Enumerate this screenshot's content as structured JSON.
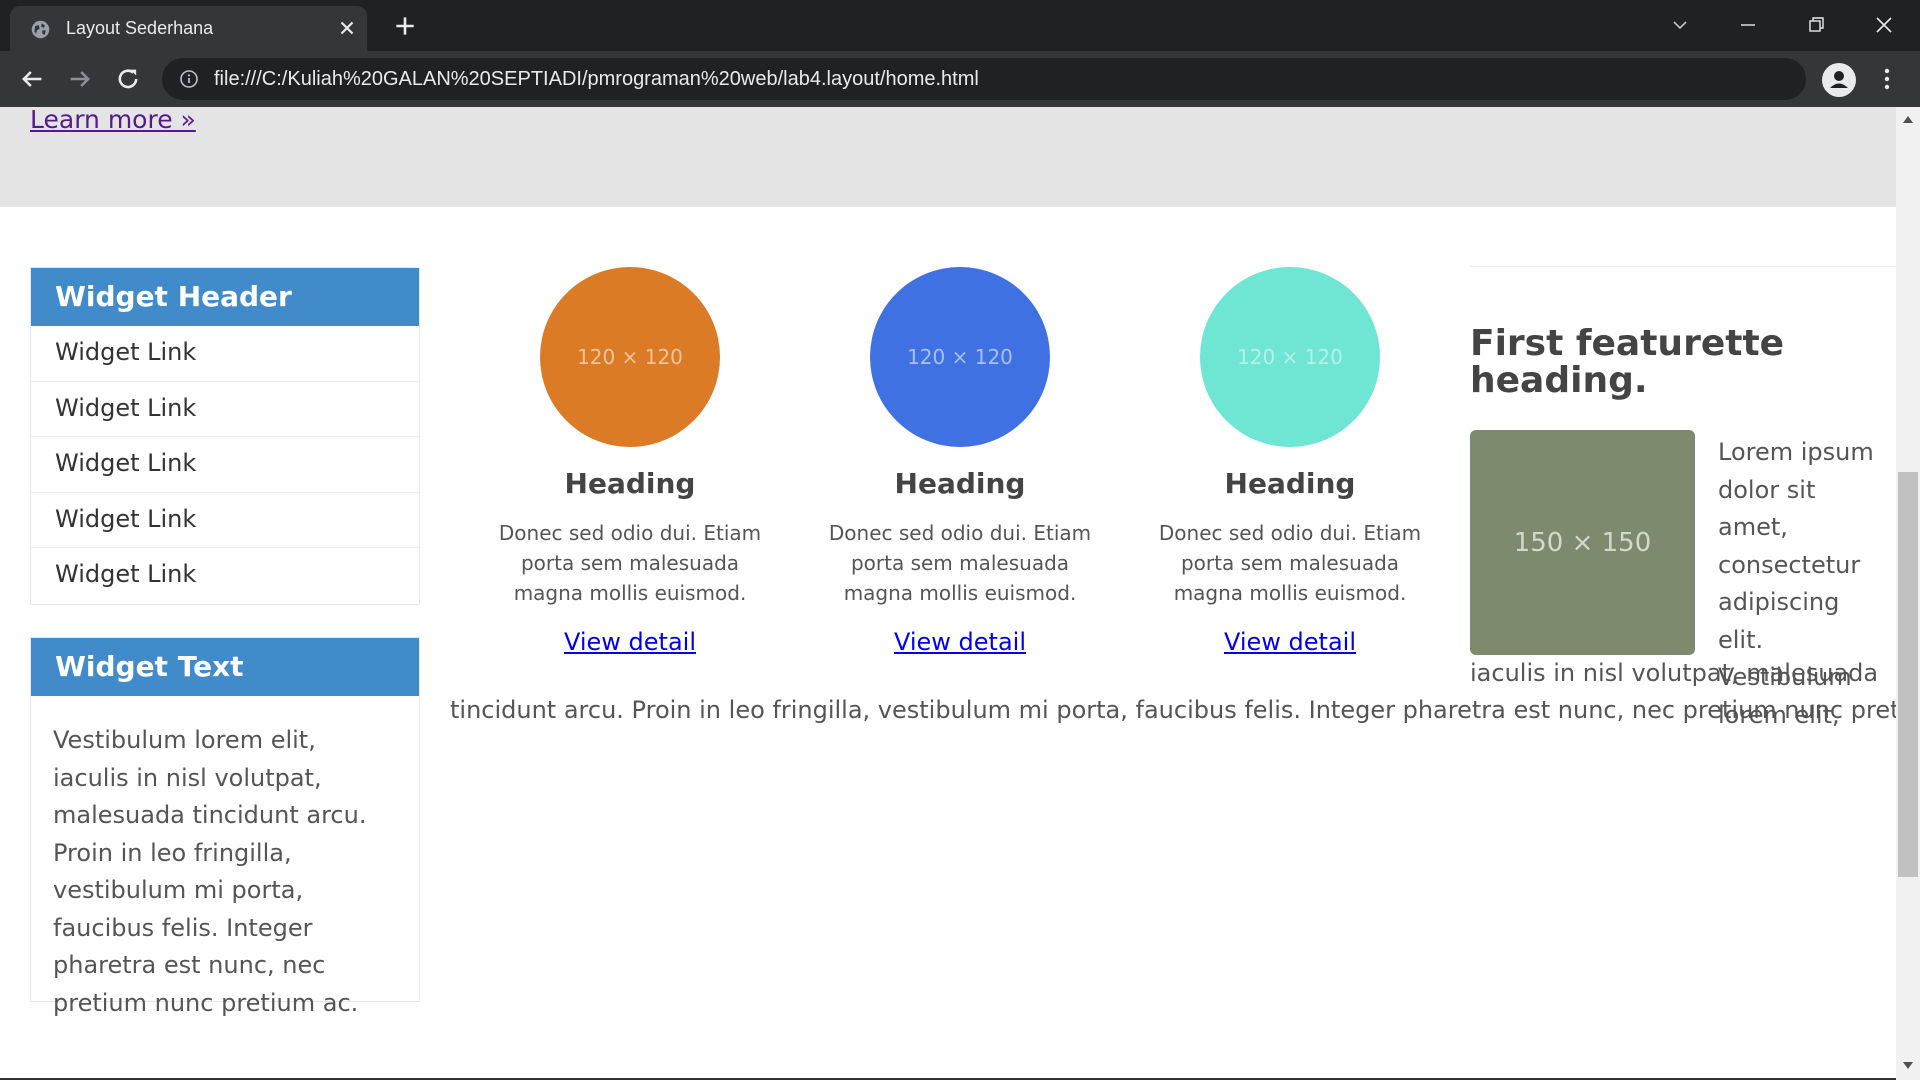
{
  "browser": {
    "tab_title": "Layout Sederhana",
    "url": "file:///C:/Kuliah%20GALAN%20SEPTIADI/pmrograman%20web/lab4.layout/home.html"
  },
  "jumbotron": {
    "learn_more": "Learn more »"
  },
  "widgets": {
    "links_header": "Widget Header",
    "links": [
      "Widget Link",
      "Widget Link",
      "Widget Link",
      "Widget Link",
      "Widget Link"
    ],
    "text_header": "Widget Text",
    "text_body": "Vestibulum lorem elit, iaculis in nisl volutpat, malesuada tincidunt arcu. Proin in leo fringilla, vestibulum mi porta, faucibus felis. Integer pharetra est nunc, nec pretium nunc pretium ac."
  },
  "columns": [
    {
      "circle_label": "120 × 120",
      "circle_color": "#dc7b26",
      "heading": "Heading",
      "text": "Donec sed odio dui. Etiam porta sem malesuada magna mollis euismod.",
      "link": "View detail"
    },
    {
      "circle_label": "120 × 120",
      "circle_color": "#3f71e2",
      "heading": "Heading",
      "text": "Donec sed odio dui. Etiam porta sem malesuada magna mollis euismod.",
      "link": "View detail"
    },
    {
      "circle_label": "120 × 120",
      "circle_color": "#6fe5d4",
      "heading": "Heading",
      "text": "Donec sed odio dui. Etiam porta sem malesuada magna mollis euismod.",
      "link": "View detail"
    }
  ],
  "featurette": {
    "heading": "First featurette heading.",
    "image_label": "150 × 150",
    "image_color": "#7e8a6e",
    "text_side": "Lorem ipsum dolor sit amet, consectetur adipiscing elit. Vestibulum lorem elit,",
    "text_line": "iaculis in nisl volutpat, malesuada",
    "text_full": "tincidunt arcu. Proin in leo fringilla, vestibulum mi porta, faucibus felis. Integer pharetra est nunc, nec pretium nunc pretium ac."
  }
}
